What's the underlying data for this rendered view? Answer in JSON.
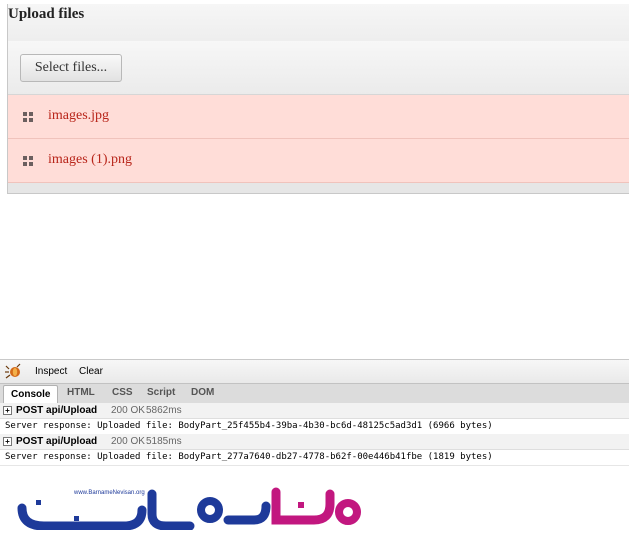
{
  "upload": {
    "title": "Upload files",
    "select_label": "Select files...",
    "files": [
      {
        "name": "images.jpg",
        "state": "error"
      },
      {
        "name": "images (1).png",
        "state": "error"
      }
    ],
    "colors": {
      "row_bg": "#ffddd8",
      "file_text": "#b8251a"
    }
  },
  "firebug": {
    "toolbar": {
      "inspect": "Inspect",
      "clear": "Clear"
    },
    "tabs": [
      "Console",
      "HTML",
      "CSS",
      "Script",
      "DOM"
    ],
    "active_tab": "Console",
    "requests": [
      {
        "method_url": "POST api/Upload",
        "status": "200 OK",
        "time": "5862ms",
        "response": "Server response: Uploaded file: BodyPart_25f455b4-39ba-4b30-bc6d-48125c5ad3d1 (6966 bytes)"
      },
      {
        "method_url": "POST api/Upload",
        "status": "200 OK",
        "time": "5185ms",
        "response": "Server response: Uploaded file: BodyPart_277a7640-db27-4778-b62f-00e446b41fbe (1819 bytes)"
      }
    ]
  },
  "watermark": {
    "site": "www.BarnameNevisan.org",
    "logo_text": "برنامه نویسان",
    "colors": {
      "blue": "#1e3a9a",
      "magenta": "#c2177f"
    }
  }
}
